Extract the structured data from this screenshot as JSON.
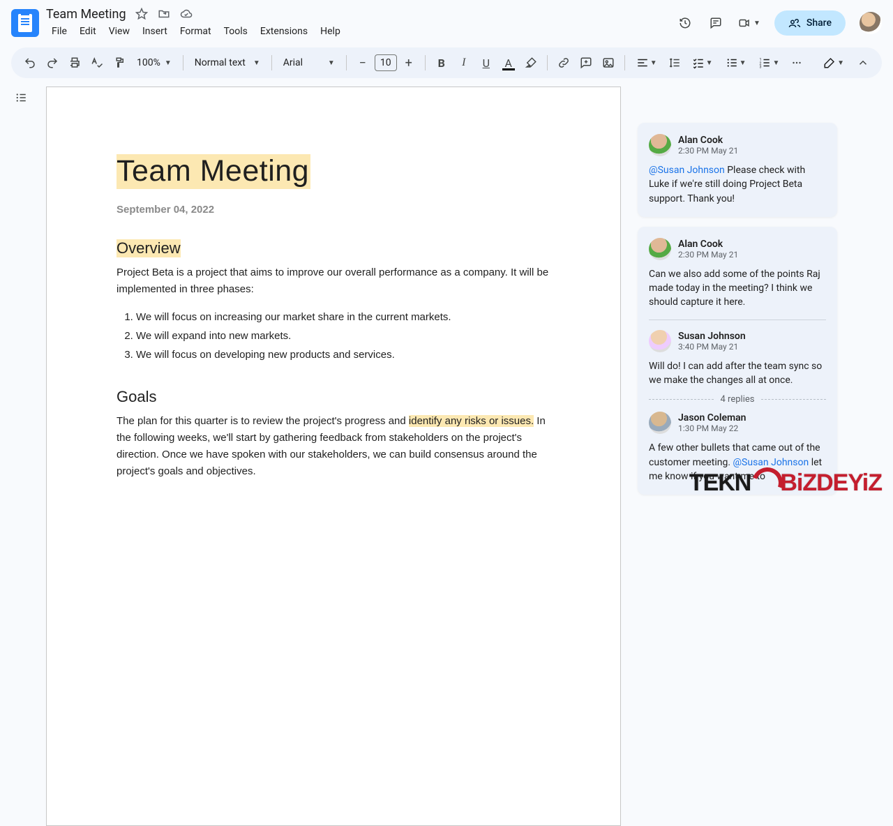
{
  "header": {
    "doc_title": "Team Meeting",
    "menus": [
      "File",
      "Edit",
      "View",
      "Insert",
      "Format",
      "Tools",
      "Extensions",
      "Help"
    ],
    "share_label": "Share"
  },
  "toolbar": {
    "zoom": "100%",
    "style": "Normal text",
    "font": "Arial",
    "font_size": "10"
  },
  "document": {
    "title": "Team Meeting",
    "date": "September 04, 2022",
    "h_overview": "Overview",
    "overview_para": "Project Beta is a project that aims to improve our overall performance as a company. It will be implemented in three phases:",
    "phases": [
      "We will focus on increasing our market share in the current markets.",
      "We will expand into new markets.",
      "We will focus on developing new products and services."
    ],
    "h_goals": "Goals",
    "goals_para_pre": "The plan for this quarter is to review the project's progress and ",
    "goals_para_hl": "identify any risks or issues.",
    "goals_para_post": " In the following weeks, we'll start by gathering feedback from stakeholders on the project's direction. Once we have spoken with our stakeholders, we can build consensus around the project's goals and objectives."
  },
  "comments": {
    "c1": {
      "name": "Alan Cook",
      "time": "2:30 PM May 21",
      "mention": "@Susan Johnson",
      "body": " Please check with Luke if we're still doing Project Beta support. Thank you!"
    },
    "c2": {
      "name": "Alan Cook",
      "time": "2:30 PM May 21",
      "body": "Can we also add some of the points Raj made today in the meeting? I think we should capture it here."
    },
    "c2r1": {
      "name": "Susan Johnson",
      "time": "3:40 PM May 21",
      "body": "Will do! I can add after the team sync so we make the changes all at once."
    },
    "replies_label": "4 replies",
    "c2r2": {
      "name": "Jason Coleman",
      "time": "1:30 PM May 22",
      "body_pre": "A few other bullets that came out of the customer meeting. ",
      "mention": "@Susan Johnson",
      "body_post": " let me know if you want me to"
    }
  },
  "watermark": {
    "a": "TEKN",
    "b": "BiZDEYiZ"
  }
}
